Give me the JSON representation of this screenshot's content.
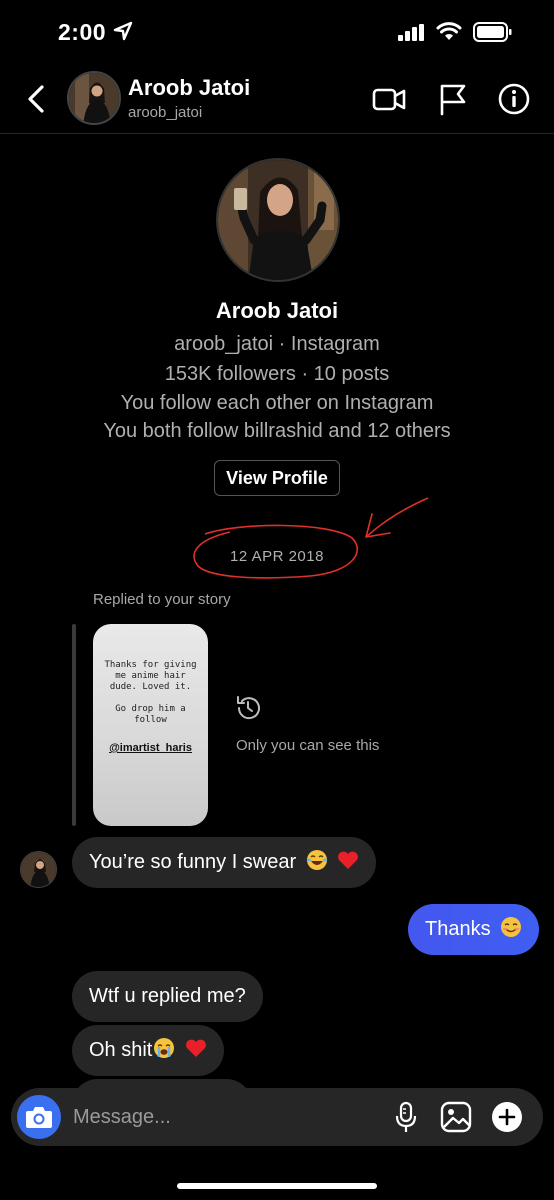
{
  "status_bar": {
    "time": "2:00"
  },
  "header": {
    "name": "Aroob Jatoi",
    "username": "aroob_jatoi"
  },
  "profile": {
    "name": "Aroob Jatoi",
    "line1": "aroob_jatoi · Instagram",
    "line2": "153K followers · 10 posts",
    "line3": "You follow each other on Instagram",
    "line4": "You both follow billrashid and 12 others",
    "view_profile_label": "View Profile"
  },
  "thread": {
    "date": "12 APR 2018",
    "replied_label": "Replied to your story",
    "story_text": "Thanks for giving\nme anime hair\ndude. Loved it.\n\nGo drop him a\nfollow",
    "story_tag": "@imartist_haris",
    "only_you_label": "Only you can see this",
    "messages": [
      {
        "text": "You’re so funny I swear",
        "direction": "incoming"
      },
      {
        "text": "Thanks",
        "direction": "outgoing"
      },
      {
        "text": "Wtf u replied me?",
        "direction": "incoming"
      },
      {
        "text": "Oh shit",
        "direction": "incoming"
      }
    ]
  },
  "composer": {
    "placeholder": "Message..."
  },
  "colors": {
    "accent": "#3f5ef2",
    "bubble_incoming": "#262626",
    "annotation": "#e0302a",
    "camera_button": "#3a70f0"
  },
  "icons": [
    "location-arrow-icon",
    "signal-icon",
    "wifi-icon",
    "battery-icon",
    "back-chevron-icon",
    "video-call-icon",
    "flag-icon",
    "info-icon",
    "history-icon",
    "camera-icon",
    "microphone-icon",
    "gallery-icon",
    "plus-icon"
  ]
}
